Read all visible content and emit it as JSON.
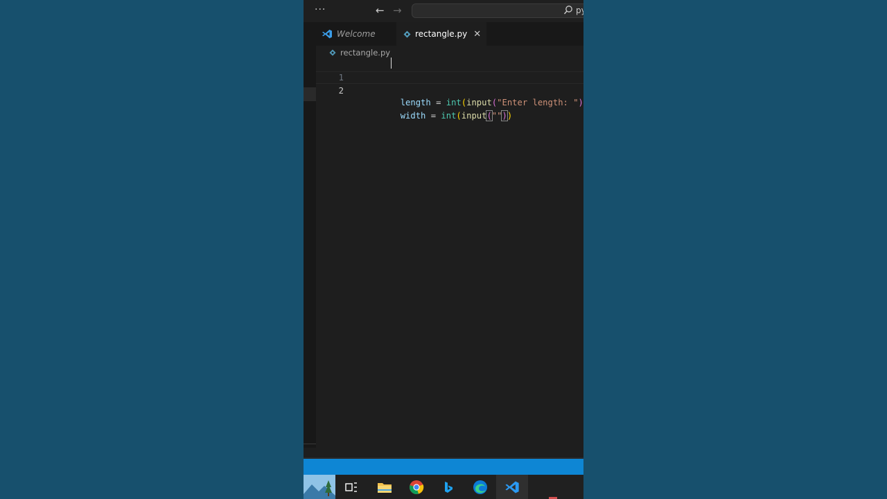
{
  "titlebar": {
    "menu_label": "···",
    "search_text": "py"
  },
  "tabs": [
    {
      "label": "Welcome"
    },
    {
      "label": "rectangle.py",
      "close": "✕"
    }
  ],
  "breadcrumb": {
    "file": "rectangle.py"
  },
  "editor": {
    "lines": [
      {
        "number": "1",
        "tokens": [
          {
            "text": "length",
            "cls": "var"
          },
          {
            "text": " = ",
            "cls": "op"
          },
          {
            "text": "int",
            "cls": "fn"
          },
          {
            "text": "(",
            "cls": "p1"
          },
          {
            "text": "input",
            "cls": "fn2"
          },
          {
            "text": "(",
            "cls": "p2"
          },
          {
            "text": "\"Enter length: \"",
            "cls": "str"
          },
          {
            "text": ")",
            "cls": "p2"
          },
          {
            "text": ")",
            "cls": "p1"
          }
        ]
      },
      {
        "number": "2",
        "tokens": [
          {
            "text": "width",
            "cls": "var"
          },
          {
            "text": " = ",
            "cls": "op"
          },
          {
            "text": "int",
            "cls": "fn"
          },
          {
            "text": "(",
            "cls": "p1"
          },
          {
            "text": "input",
            "cls": "fn2"
          },
          {
            "text": "(",
            "cls": "p2"
          },
          {
            "text": "\"\"",
            "cls": "str"
          },
          {
            "text": ")",
            "cls": "p2"
          },
          {
            "text": ")",
            "cls": "p1"
          }
        ]
      }
    ]
  },
  "colors": {
    "desktop": "#17506d",
    "statusbar": "#0e86d4",
    "accent": "#0078d4"
  },
  "taskbar": {
    "apps": [
      "desktop-thumbnail",
      "task-view-icon",
      "file-explorer-icon",
      "chrome-icon",
      "bing-icon",
      "edge-icon",
      "vscode-icon"
    ]
  }
}
